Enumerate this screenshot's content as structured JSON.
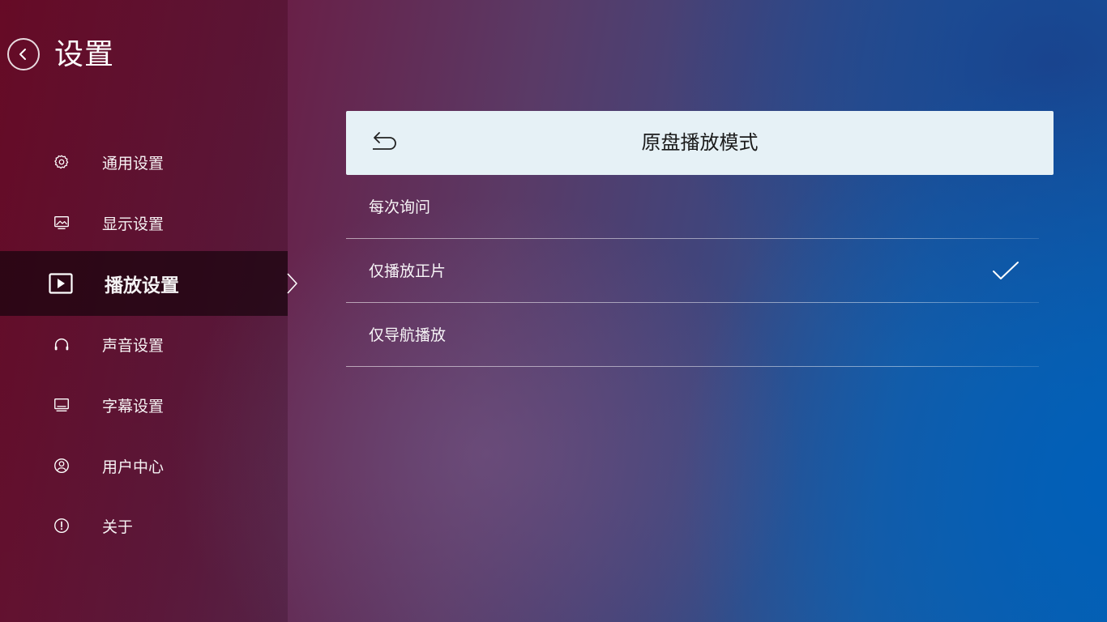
{
  "header": {
    "title": "设置",
    "back_icon": "chevron-left-circle-icon"
  },
  "sidebar": {
    "items": [
      {
        "label": "通用设置",
        "icon": "gear-icon",
        "active": false
      },
      {
        "label": "显示设置",
        "icon": "display-image-icon",
        "active": false
      },
      {
        "label": "播放设置",
        "icon": "play-icon",
        "active": true
      },
      {
        "label": "声音设置",
        "icon": "headphones-icon",
        "active": false
      },
      {
        "label": "字幕设置",
        "icon": "subtitle-monitor-icon",
        "active": false
      },
      {
        "label": "用户中心",
        "icon": "user-circle-icon",
        "active": false
      },
      {
        "label": "关于",
        "icon": "info-circle-icon",
        "active": false
      }
    ]
  },
  "panel": {
    "title": "原盘播放模式",
    "back_icon": "return-arrow-icon",
    "options": [
      {
        "label": "每次询问",
        "selected": false
      },
      {
        "label": "仅播放正片",
        "selected": true
      },
      {
        "label": "仅导航播放",
        "selected": false
      }
    ]
  },
  "colors": {
    "panel_header_bg": "#e6f1f6",
    "active_item_bg": "#19040e",
    "background_left": "#7a0f2e",
    "background_right": "#0a60ad"
  }
}
